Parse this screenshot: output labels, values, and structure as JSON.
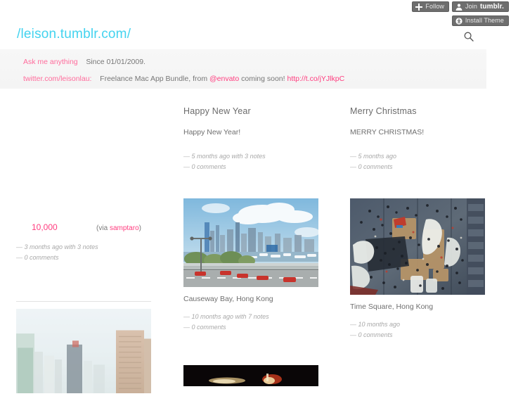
{
  "tumblr_bar": {
    "follow_label": "Follow",
    "join_label": "Join",
    "join_brand": "tumblr.",
    "install_label": "Install Theme"
  },
  "header": {
    "title": "/leison.tumblr.com/",
    "title_color": "#43d3ef",
    "search_icon": "search-icon"
  },
  "nav": {
    "ask_label": "Ask me anything",
    "since_text": "Since 01/01/2009.",
    "twitter_handle": "twitter.com/leisonlau:",
    "tweet_part1": "Freelance Mac App Bundle, from ",
    "tweet_mention": "@envato",
    "tweet_part2": " coming soon! ",
    "tweet_link": "http://t.co/jYJlkpC",
    "accent_color": "#ff6c9c"
  },
  "posts": {
    "happy_new_year": {
      "title": "Happy New Year",
      "body": "Happy New Year!",
      "meta_notes": "5 months ago with 3 notes",
      "meta_comments": "0 comments"
    },
    "merry_christmas": {
      "title": "Merry Christmas",
      "body": "MERRY CHRISTMAS!",
      "meta_notes": "5 months ago",
      "meta_comments": "0 comments"
    },
    "quote_10000": {
      "number": "10,000",
      "via_prefix": "(via ",
      "via_source": "samptaro",
      "via_suffix": ")",
      "meta_notes": "3 months ago with 3 notes",
      "meta_comments": "0 comments"
    },
    "causeway_bay": {
      "caption": "Causeway Bay, Hong Kong",
      "meta_notes": "10 months ago with 7 notes",
      "meta_comments": "0 comments",
      "alt": "hong-kong-harbour-photo"
    },
    "time_square": {
      "caption": "Time Square, Hong Kong",
      "meta_notes": "10 months ago",
      "meta_comments": "0 comments",
      "alt": "aerial-plaza-crowd-photo"
    },
    "skyline": {
      "alt": "hazy-city-skyline-photo"
    },
    "night_fire": {
      "alt": "night-fire-photo"
    }
  },
  "dash": "—"
}
